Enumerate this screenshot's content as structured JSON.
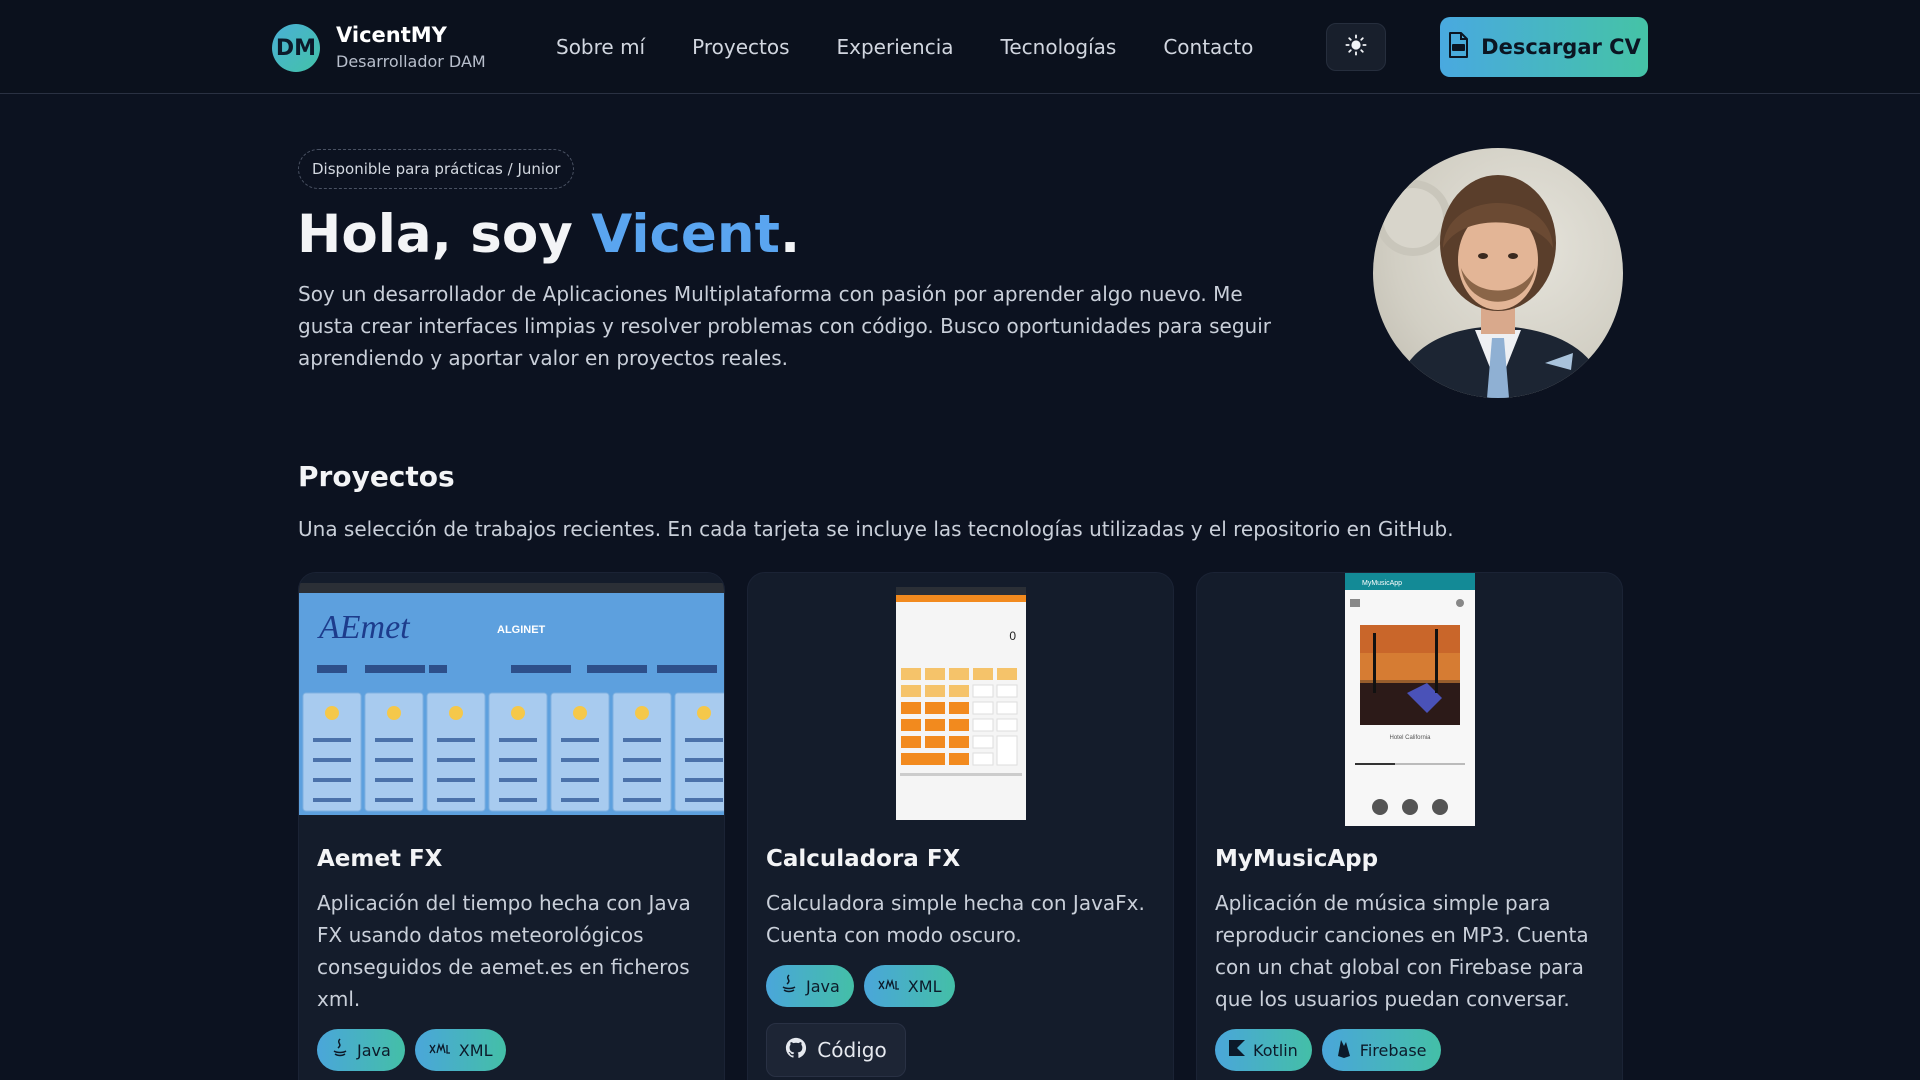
{
  "header": {
    "avatar_initials": "DM",
    "brand_name": "VicentMY",
    "brand_role": "Desarrollador DAM",
    "nav": [
      "Sobre mí",
      "Proyectos",
      "Experiencia",
      "Tecnologías",
      "Contacto"
    ],
    "theme_icon": "sun-icon",
    "cv_button": "Descargar CV",
    "cv_icon": "pdf-file-icon"
  },
  "hero": {
    "badge": "Disponible para prácticas / Junior",
    "title_prefix": "Hola, soy ",
    "title_name": "Vicent",
    "title_suffix": ".",
    "description": "Soy un desarrollador de Aplicaciones Multiplataforma con pasión por aprender algo nuevo. Me gusta crear interfaces limpias y resolver problemas con código. Busco oportunidades para seguir aprendiendo y aportar valor en proyectos reales."
  },
  "projects": {
    "title": "Proyectos",
    "subtitle": "Una selección de trabajos recientes. En cada tarjeta se incluye las tecnologías utilizadas y el repositorio en GitHub.",
    "cards": [
      {
        "title": "Aemet FX",
        "description": "Aplicación del tiempo hecha con Java FX usando datos meteorológicos conseguidos de aemet.es en ficheros xml.",
        "tags": [
          "Java",
          "XML"
        ],
        "screenshot_logo": "AEmet",
        "screenshot_header": "ALGINET"
      },
      {
        "title": "Calculadora FX",
        "description": "Calculadora simple hecha con JavaFx. Cuenta con modo oscuro.",
        "tags": [
          "Java",
          "XML"
        ],
        "code_button": "Código",
        "screenshot_display": "0"
      },
      {
        "title": "MyMusicApp",
        "description": "Aplicación de música simple para reproducir canciones en MP3. Cuenta con un chat global con Firebase para que los usuarios puedan conversar.",
        "tags": [
          "Kotlin",
          "Firebase"
        ],
        "screenshot_appbar": "MyMusicApp",
        "screenshot_song": "Hotel California"
      }
    ]
  },
  "colors": {
    "background": "#0c1220",
    "accent": "#5aa5f0",
    "gradient_start": "#49a9e0",
    "gradient_end": "#45c3a6"
  }
}
